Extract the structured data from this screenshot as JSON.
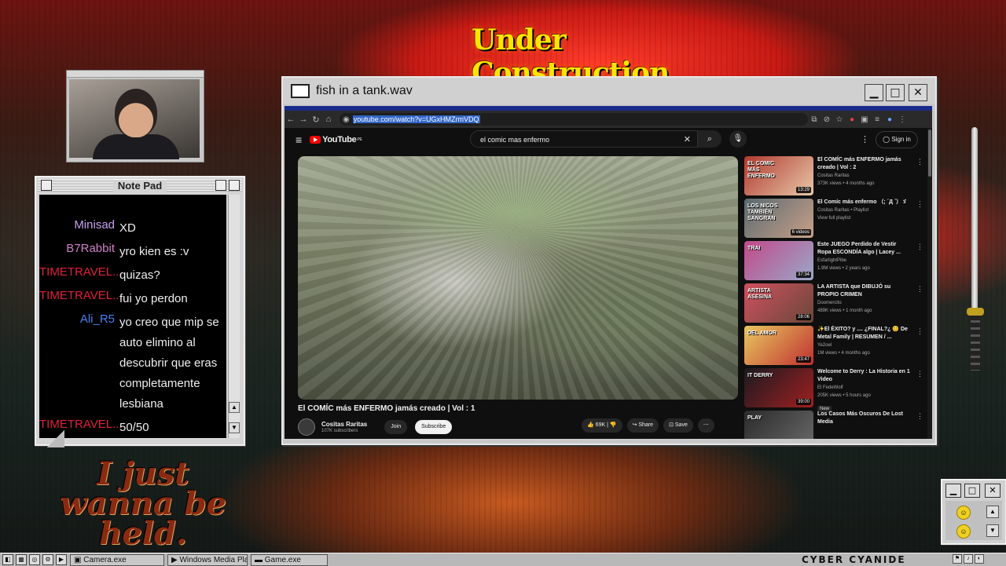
{
  "desktop": {
    "banner": "Under Construction",
    "tagline": "I just wanna be held.",
    "brand": "CYBER CYANIDE"
  },
  "notepad": {
    "title": "Note Pad",
    "chat": [
      {
        "user": "Minisad",
        "color": "#c8a0f0",
        "text": "XD"
      },
      {
        "user": "B7Rabbit",
        "color": "#d080c8",
        "text": "yro kien es :v"
      },
      {
        "user": "TIMETRAVEL...",
        "color": "#e0203a",
        "text": "quizas?"
      },
      {
        "user": "TIMETRAVEL...",
        "color": "#e0203a",
        "text": "fui yo perdon"
      },
      {
        "user": "Ali_R5",
        "color": "#4a80f0",
        "text": "yo creo que mip se auto elimino al descubrir que eras completamente lesbiana"
      },
      {
        "user": "TIMETRAVEL...",
        "color": "#e0203a",
        "text": "50/50"
      }
    ]
  },
  "window": {
    "title": "fish in a tank.wav",
    "min_label": "▁",
    "max_label": "□",
    "close_label": "✕"
  },
  "browser": {
    "url": "youtube.com/watch?v=UGxHMZrmVDQ"
  },
  "youtube": {
    "logo": "YouTube",
    "country": "PE",
    "search_value": "el comic mas enfermo",
    "sign_in": "Sign in",
    "video_title": "El COMÍC más ENFERMO jamás creado | Vol : 1",
    "channel": "Cositas Raritas",
    "subscribers": "107K subscribers",
    "join": "Join",
    "subscribe": "Subscribe",
    "likes": "69K",
    "share": "Share",
    "save": "Save",
    "sidebar": [
      {
        "title": "El COMÍC más ENFERMO jamás creado | Vol : 2",
        "channel": "Cositas Raritas",
        "meta": "373K views • 4 months ago",
        "duration": "13:29",
        "thumb": "#b03a30",
        "thumb2": "#e8c8a8",
        "label": "EL COMIC MÁS ENFERMO"
      },
      {
        "title": "El Comíc más enfermo （; ´Д `）ゞ",
        "channel": "Cositas Raritas • Playlist",
        "meta": "View full playlist",
        "duration": "6 videos",
        "thumb": "#5a6a70",
        "thumb2": "#c8a088",
        "label": "LOS NICOS TAMBIÉN SANGRAN"
      },
      {
        "title": "Este JUEGO Perdido de Vestir Ropa ESCONDÍA algo | Lacey ...",
        "channel": "EsfarlightPibe",
        "meta": "1.9M views • 2 years ago",
        "duration": "37:34",
        "thumb": "#c04a8a",
        "thumb2": "#9aa8c8",
        "label": "TRAI"
      },
      {
        "title": "LA ARTISTA que DIBUJÓ su PROPIO CRIMEN",
        "channel": "Doomercito",
        "meta": "489K views • 1 month ago",
        "duration": "28:06",
        "thumb": "#d05060",
        "thumb2": "#6a4838",
        "label": "ARTISTA ASESINA"
      },
      {
        "title": "✨El ÉXITO? y .... ¿FINAL?¿ 😊 De Metal Family | RESUMEN / ...",
        "channel": "Ye2oel",
        "meta": "1M views • 4 months ago",
        "duration": "23:47",
        "thumb": "#e8c860",
        "thumb2": "#c03030",
        "label": "DEL AMOR"
      },
      {
        "title": "Welcome to Derry : La Historia en 1 Video",
        "channel": "El FedeWolf",
        "meta": "205K views • 5 hours ago",
        "duration": "39:00",
        "thumb": "#1a1a20",
        "thumb2": "#a02020",
        "label": "IT DERRY",
        "badge": "New"
      },
      {
        "title": "Los Casos Más Oscuros De Lost Media",
        "channel": "",
        "meta": "",
        "duration": "",
        "thumb": "#2a2a2a",
        "thumb2": "#6a6a6a",
        "label": "PLAY"
      }
    ]
  },
  "taskbar": {
    "tasks": [
      "Camera.exe",
      "Windows Media Pla",
      "Game.exe"
    ]
  }
}
